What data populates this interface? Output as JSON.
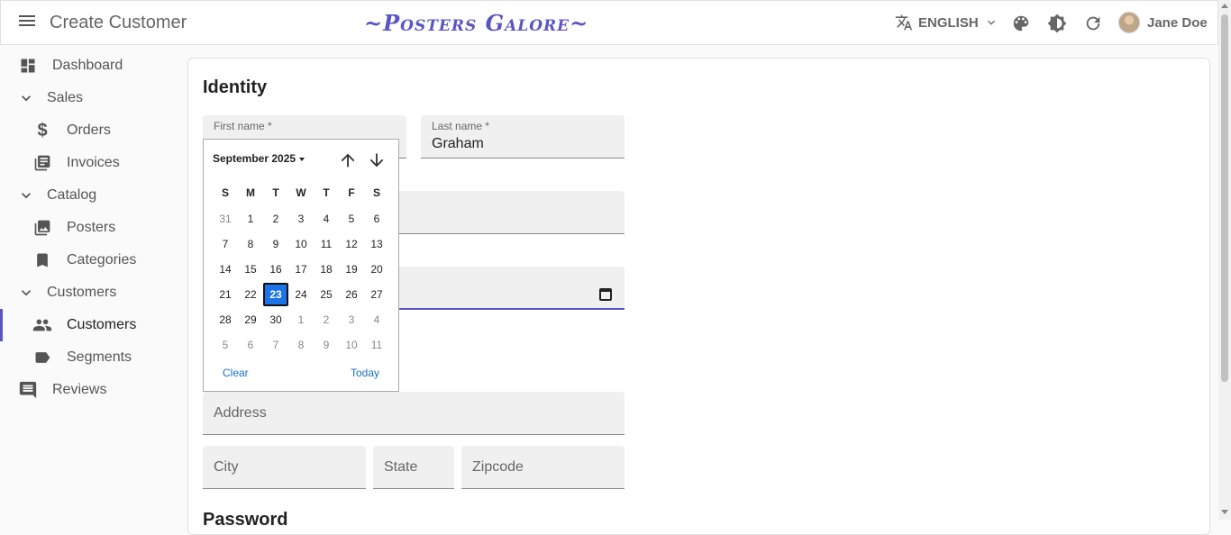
{
  "appbar": {
    "title": "Create Customer",
    "brand": "~Posters Galore~",
    "language": "ENGLISH",
    "user": "Jane Doe"
  },
  "sidebar": {
    "items": [
      {
        "label": "Dashboard",
        "icon": "dashboard-icon"
      },
      {
        "label": "Sales",
        "icon": "chevron-down-icon"
      },
      {
        "label": "Orders",
        "icon": "dollar-icon"
      },
      {
        "label": "Invoices",
        "icon": "invoices-icon"
      },
      {
        "label": "Catalog",
        "icon": "chevron-down-icon"
      },
      {
        "label": "Posters",
        "icon": "image-icon"
      },
      {
        "label": "Categories",
        "icon": "bookmark-icon"
      },
      {
        "label": "Customers",
        "icon": "chevron-down-icon"
      },
      {
        "label": "Customers",
        "icon": "people-icon"
      },
      {
        "label": "Segments",
        "icon": "label-icon"
      },
      {
        "label": "Reviews",
        "icon": "comment-icon"
      }
    ]
  },
  "form": {
    "identity_title": "Identity",
    "first_name_label": "First name *",
    "last_name_label": "Last name *",
    "last_name_value": "Graham",
    "address_placeholder": "Address",
    "city_placeholder": "City",
    "state_placeholder": "State",
    "zipcode_placeholder": "Zipcode",
    "password_title": "Password"
  },
  "datepicker": {
    "month_label": "September 2025",
    "weekdays": [
      "S",
      "M",
      "T",
      "W",
      "T",
      "F",
      "S"
    ],
    "weeks": [
      [
        "31",
        "1",
        "2",
        "3",
        "4",
        "5",
        "6"
      ],
      [
        "7",
        "8",
        "9",
        "10",
        "11",
        "12",
        "13"
      ],
      [
        "14",
        "15",
        "16",
        "17",
        "18",
        "19",
        "20"
      ],
      [
        "21",
        "22",
        "23",
        "24",
        "25",
        "26",
        "27"
      ],
      [
        "28",
        "29",
        "30",
        "1",
        "2",
        "3",
        "4"
      ],
      [
        "5",
        "6",
        "7",
        "8",
        "9",
        "10",
        "11"
      ]
    ],
    "selected_day": "23",
    "clear_label": "Clear",
    "today_label": "Today"
  },
  "colors": {
    "accent": "#5a55c4",
    "selected_day": "#1a73e8",
    "link": "#1a6fc4"
  }
}
